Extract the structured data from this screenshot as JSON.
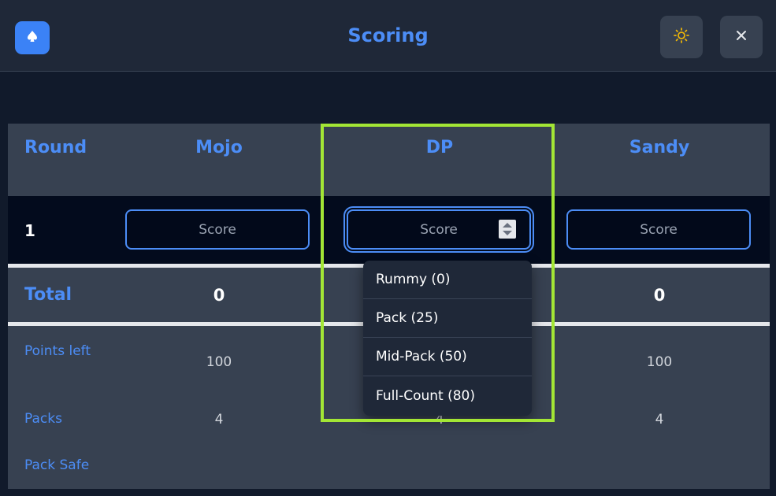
{
  "header": {
    "title": "Scoring",
    "logo_icon": "spade-icon",
    "theme_icon": "sun-icon",
    "close_icon": "close-icon"
  },
  "table": {
    "headers": [
      "Round",
      "Mojo",
      "DP",
      "Sandy"
    ],
    "round_number": "1",
    "score_placeholder": "Score",
    "total_label": "Total",
    "totals": [
      "0",
      "0"
    ],
    "points_left_label": "Points left",
    "points_left": [
      "100",
      "100"
    ],
    "packs_label": "Packs",
    "packs": [
      "4",
      "4",
      "4"
    ],
    "pack_safe_label": "Pack Safe"
  },
  "dropdown": {
    "options": [
      "Rummy (0)",
      "Pack (25)",
      "Mid-Pack (50)",
      "Full-Count (80)"
    ]
  },
  "colors": {
    "accent": "#4c8df6",
    "highlight": "#a3e635",
    "panel": "#374151",
    "background": "#111a2b"
  }
}
